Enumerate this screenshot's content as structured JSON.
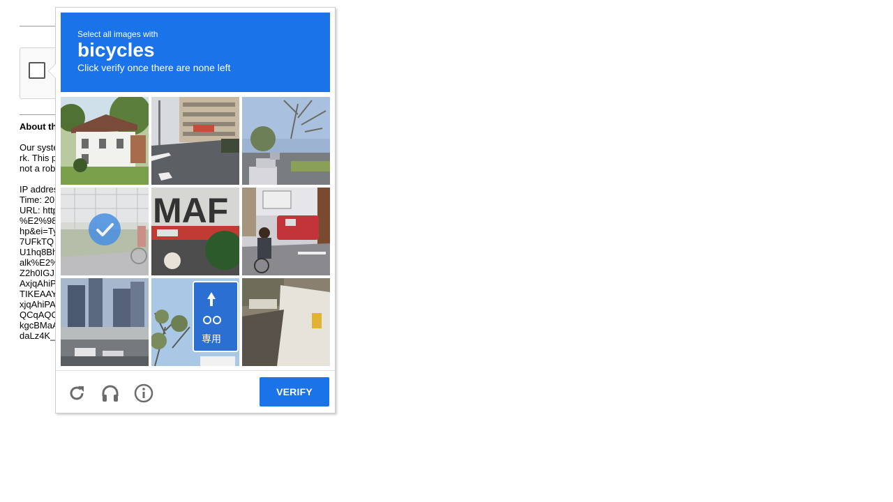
{
  "background_page": {
    "heading": "About th",
    "body_lines": [
      "Our syste",
      "rk. This p",
      "not a rob",
      "",
      "IP addres",
      "Time: 20",
      "URL: http",
      "%E2%98",
      "hp&ei=Ty",
      "7UFkTQ",
      "U1hq8Bh",
      "alk%E2%",
      "Z2h0IGJ",
      "AxjqAhiP",
      "TIKEAAY",
      "xjqAhiPA",
      "QCqAQC",
      "kgcBMaA",
      "daLz4K_"
    ]
  },
  "challenge": {
    "instruction_line1": "Select all images with",
    "target_object": "bicycles",
    "instruction_line3": "Click verify once there are none left",
    "verify_label": "VERIFY",
    "tiles": [
      {
        "selected": false
      },
      {
        "selected": false
      },
      {
        "selected": false
      },
      {
        "selected": true
      },
      {
        "selected": false
      },
      {
        "selected": false
      },
      {
        "selected": false
      },
      {
        "selected": false
      },
      {
        "selected": false
      }
    ],
    "icons": [
      "reload-icon",
      "headphones-icon",
      "info-icon"
    ],
    "colors": {
      "accent": "#1a73e8",
      "check": "#4a90e2"
    }
  }
}
